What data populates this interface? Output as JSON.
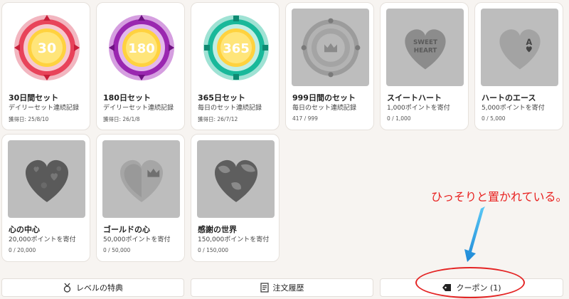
{
  "cards": [
    {
      "title": "30日間セット",
      "sub": "デイリーセット連続記録",
      "meta": "獲得日: 25/8/10",
      "badge_text": "30",
      "badge_color": "#e8435a"
    },
    {
      "title": "180日セット",
      "sub": "デイリーセット連続記録",
      "meta": "獲得日: 26/1/8",
      "badge_text": "180",
      "badge_color": "#9a27b0"
    },
    {
      "title": "365日セット",
      "sub": "毎日のセット連続記録",
      "meta": "獲得日: 26/7/12",
      "badge_text": "365",
      "badge_color": "#19b89a"
    },
    {
      "title": "999日間のセット",
      "sub": "毎日のセット連続記録",
      "meta": "417 / 999"
    },
    {
      "title": "スイートハート",
      "sub": "1,000ポイントを寄付",
      "meta": "0 / 1,000",
      "heart_text_1": "SWEET",
      "heart_text_2": "HEART"
    },
    {
      "title": "ハートのエース",
      "sub": "5,000ポイントを寄付",
      "meta": "0 / 5,000",
      "ace_text": "A"
    },
    {
      "title": "心の中心",
      "sub": "20,000ポイントを寄付",
      "meta": "0 / 20,000"
    },
    {
      "title": "ゴールドの心",
      "sub": "50,000ポイントを寄付",
      "meta": "0 / 50,000"
    },
    {
      "title": "感謝の世界",
      "sub": "150,000ポイントを寄付",
      "meta": "0 / 150,000"
    }
  ],
  "bottom": {
    "level_label": "レベルの特典",
    "orders_label": "注文履歴",
    "coupon_label": "クーポン (1)"
  },
  "annotation": {
    "text": "ひっそりと置かれている。",
    "color": "#e8201f"
  },
  "colors": {
    "page_bg": "#f7f4f1",
    "locked_gray": "#bdbdbd"
  }
}
